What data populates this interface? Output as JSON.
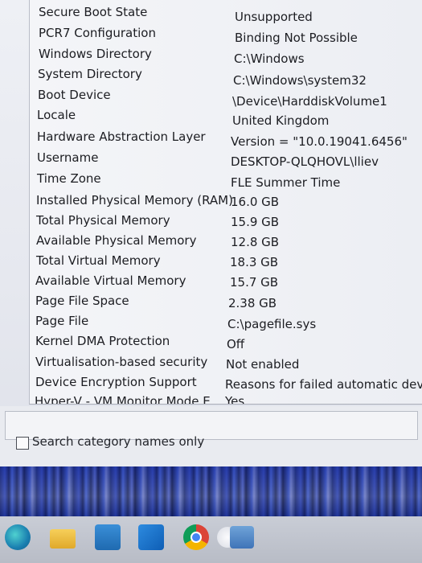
{
  "rows": [
    {
      "item": "Secure Boot State",
      "value": "Unsupported"
    },
    {
      "item": "PCR7 Configuration",
      "value": "Binding Not Possible"
    },
    {
      "item": "Windows Directory",
      "value": "C:\\Windows"
    },
    {
      "item": "System Directory",
      "value": "C:\\Windows\\system32"
    },
    {
      "item": "Boot Device",
      "value": "\\Device\\HarddiskVolume1"
    },
    {
      "item": "Locale",
      "value": "United Kingdom"
    },
    {
      "item": "Hardware Abstraction Layer",
      "value": "Version = \"10.0.19041.6456\""
    },
    {
      "item": "Username",
      "value": "DESKTOP-QLQHOVL\\lliev"
    },
    {
      "item": "Time Zone",
      "value": "FLE Summer Time"
    },
    {
      "item": "Installed Physical Memory (RAM)",
      "value": "16.0 GB"
    },
    {
      "item": "Total Physical Memory",
      "value": "15.9 GB"
    },
    {
      "item": "Available Physical Memory",
      "value": "12.8 GB"
    },
    {
      "item": "Total Virtual Memory",
      "value": "18.3 GB"
    },
    {
      "item": "Available Virtual Memory",
      "value": "15.7 GB"
    },
    {
      "item": "Page File Space",
      "value": "2.38 GB"
    },
    {
      "item": "Page File",
      "value": "C:\\pagefile.sys"
    },
    {
      "item": "Kernel DMA Protection",
      "value": "Off"
    },
    {
      "item": "Virtualisation-based security",
      "value": "Not enabled"
    },
    {
      "item": "Device Encryption Support",
      "value": "Reasons for failed automatic device"
    },
    {
      "item": "Hyper-V - VM Monitor Mode E...",
      "value": "Yes"
    }
  ],
  "search": {
    "value": "",
    "checkbox_label": "Search category names only",
    "checkbox_checked": false
  },
  "taskbar": {
    "icons": [
      "edge-icon",
      "file-explorer-icon",
      "store-icon",
      "outlook-icon",
      "chrome-icon",
      "app-icon",
      "photos-icon"
    ]
  }
}
